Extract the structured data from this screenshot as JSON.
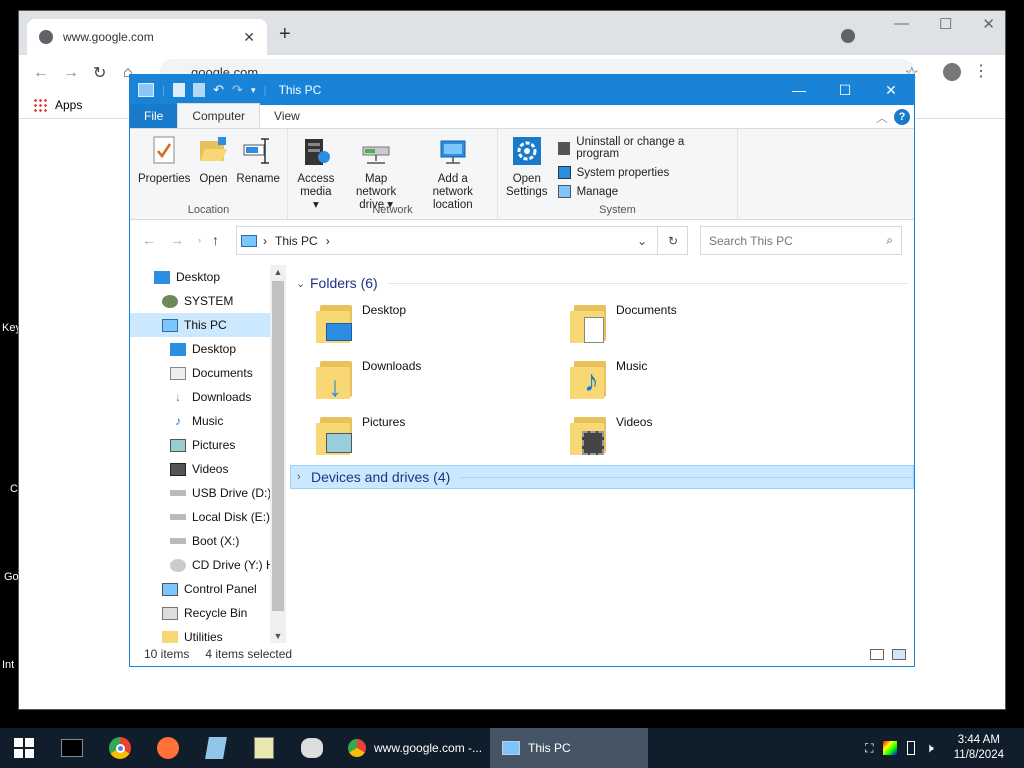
{
  "desktop": {
    "fragments": [
      "Key",
      "C",
      "Go",
      "Int"
    ]
  },
  "chrome": {
    "tab_title": "www.google.com",
    "tab_close": "✕",
    "new_tab": "+",
    "omnibox_text": "google.com",
    "bookmarks": {
      "apps_label": "Apps"
    },
    "ctrl_min": "—",
    "ctrl_max": "☐",
    "ctrl_close": "✕"
  },
  "explorer": {
    "title": "This PC",
    "ribbon_tabs": {
      "file": "File",
      "computer": "Computer",
      "view": "View"
    },
    "help": "?",
    "groups": {
      "location": {
        "label": "Location",
        "buttons": [
          "Properties",
          "Open",
          "Rename"
        ]
      },
      "network": {
        "label": "Network",
        "access_media": [
          "Access",
          "media ▾"
        ],
        "map_drive": [
          "Map network",
          "drive ▾"
        ],
        "add_location": [
          "Add a network",
          "location"
        ]
      },
      "system": {
        "label": "System",
        "open_settings": [
          "Open",
          "Settings"
        ],
        "items": [
          "Uninstall or change a program",
          "System properties",
          "Manage"
        ]
      }
    },
    "address": {
      "separator": "›",
      "path": "This PC",
      "trail": "›"
    },
    "search_placeholder": "Search This PC",
    "nav_items": [
      "Desktop",
      "SYSTEM",
      "This PC",
      "Desktop",
      "Documents",
      "Downloads",
      "Music",
      "Pictures",
      "Videos",
      "USB Drive (D:)",
      "Local Disk (E:)",
      "Boot (X:)",
      "CD Drive (Y:) H",
      "Control Panel",
      "Recycle Bin",
      "Utilities"
    ],
    "folders_header": "Folders (6)",
    "folders": [
      "Desktop",
      "Documents",
      "Downloads",
      "Music",
      "Pictures",
      "Videos"
    ],
    "devices_header": "Devices and drives (4)",
    "status": {
      "items": "10 items",
      "selected": "4 items selected"
    }
  },
  "taskbar": {
    "tasks": [
      {
        "label": "www.google.com -..."
      },
      {
        "label": "This PC"
      }
    ],
    "clock_time": "3:44 AM",
    "clock_date": "11/8/2024"
  },
  "colors": {
    "accent": "#1883d7",
    "selection": "#cce8ff",
    "taskbar": "#101e2b",
    "folder": "#f8d775"
  }
}
